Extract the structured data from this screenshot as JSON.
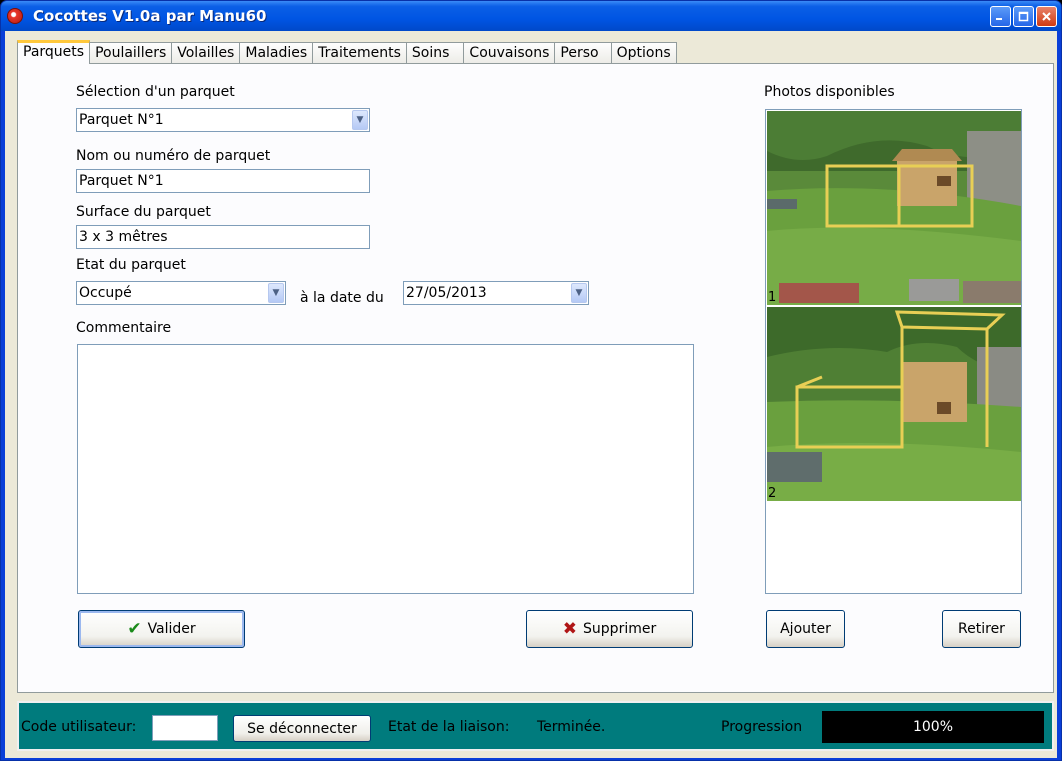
{
  "window": {
    "title": "Cocottes V1.0a par Manu60"
  },
  "tabs": [
    {
      "label": "Parquets",
      "active": true
    },
    {
      "label": "Poulaillers"
    },
    {
      "label": "Volailles"
    },
    {
      "label": "Maladies"
    },
    {
      "label": "Traitements"
    },
    {
      "label": "Soins"
    },
    {
      "label": "Couvaisons"
    },
    {
      "label": "Perso"
    },
    {
      "label": "Options"
    }
  ],
  "form": {
    "selection_label": "Sélection d'un parquet",
    "selection_value": "Parquet N°1",
    "name_label": "Nom ou numéro de parquet",
    "name_value": "Parquet N°1",
    "surface_label": "Surface du parquet",
    "surface_value": "3 x 3 mêtres",
    "state_label": "Etat du parquet",
    "state_value": "Occupé",
    "date_label": "à la date du",
    "date_value": "27/05/2013",
    "comment_label": "Commentaire",
    "comment_value": ""
  },
  "photos": {
    "label": "Photos disponibles",
    "items": [
      {
        "number": "1"
      },
      {
        "number": "2"
      }
    ]
  },
  "buttons": {
    "validate": "Valider",
    "delete": "Supprimer",
    "add": "Ajouter",
    "remove": "Retirer"
  },
  "status": {
    "user_code_label": "Code utilisateur:",
    "user_code_value": "",
    "disconnect_label": "Se déconnecter",
    "link_state_label": "Etat de la liaison:",
    "link_state_value": "Terminée.",
    "progress_label": "Progression",
    "progress_text": "100%",
    "progress_value": 1.0
  },
  "colors": {
    "titlebar": "#0055e3",
    "status_bg": "#007b7d",
    "tab_highlight": "#ffc83c"
  }
}
